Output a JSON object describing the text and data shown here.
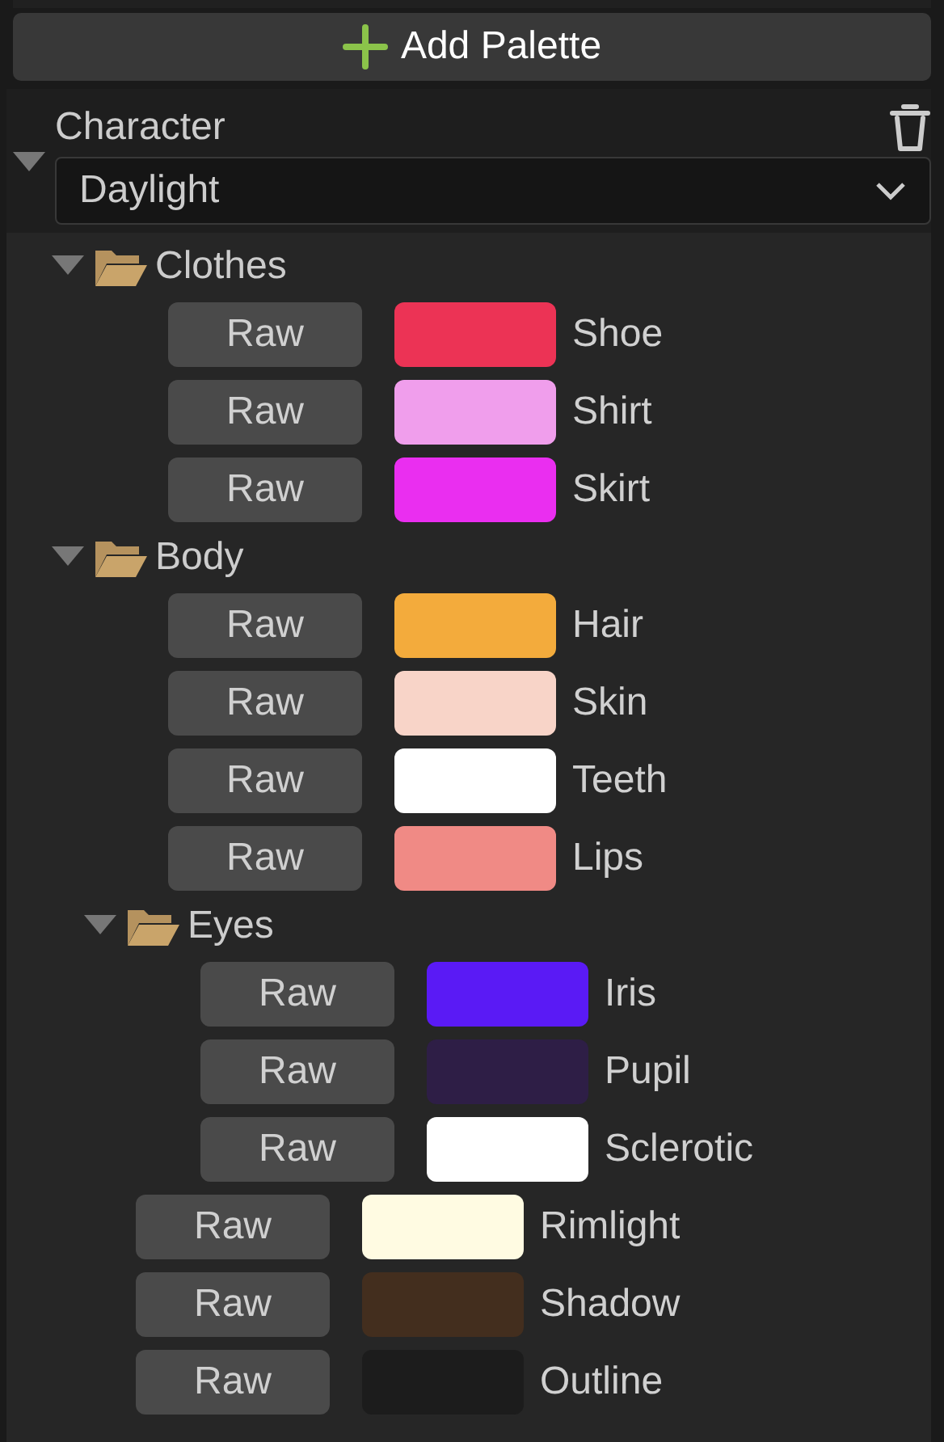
{
  "add_button": {
    "label": "Add Palette"
  },
  "palette": {
    "name": "Character",
    "expanded": true,
    "preset": "Daylight",
    "items": [
      {
        "kind": "group",
        "label": "Clothes",
        "expanded": true,
        "children": [
          {
            "kind": "color",
            "label": "Shoe",
            "button": "Raw",
            "color": "#ec3355"
          },
          {
            "kind": "color",
            "label": "Shirt",
            "button": "Raw",
            "color": "#f09eec"
          },
          {
            "kind": "color",
            "label": "Skirt",
            "button": "Raw",
            "color": "#ea2ef0"
          }
        ]
      },
      {
        "kind": "group",
        "label": "Body",
        "expanded": true,
        "children": [
          {
            "kind": "color",
            "label": "Hair",
            "button": "Raw",
            "color": "#f3ab3c"
          },
          {
            "kind": "color",
            "label": "Skin",
            "button": "Raw",
            "color": "#f8d4c8"
          },
          {
            "kind": "color",
            "label": "Teeth",
            "button": "Raw",
            "color": "#ffffff"
          },
          {
            "kind": "color",
            "label": "Lips",
            "button": "Raw",
            "color": "#f08a85"
          },
          {
            "kind": "group",
            "label": "Eyes",
            "expanded": true,
            "children": [
              {
                "kind": "color",
                "label": "Iris",
                "button": "Raw",
                "color": "#5a1af5"
              },
              {
                "kind": "color",
                "label": "Pupil",
                "button": "Raw",
                "color": "#2e1e46"
              },
              {
                "kind": "color",
                "label": "Sclerotic",
                "button": "Raw",
                "color": "#ffffff"
              }
            ]
          }
        ]
      },
      {
        "kind": "color",
        "label": "Rimlight",
        "button": "Raw",
        "color": "#fffbe2"
      },
      {
        "kind": "color",
        "label": "Shadow",
        "button": "Raw",
        "color": "#432e1e"
      },
      {
        "kind": "color",
        "label": "Outline",
        "button": "Raw",
        "color": "#1c1c1c"
      }
    ]
  }
}
